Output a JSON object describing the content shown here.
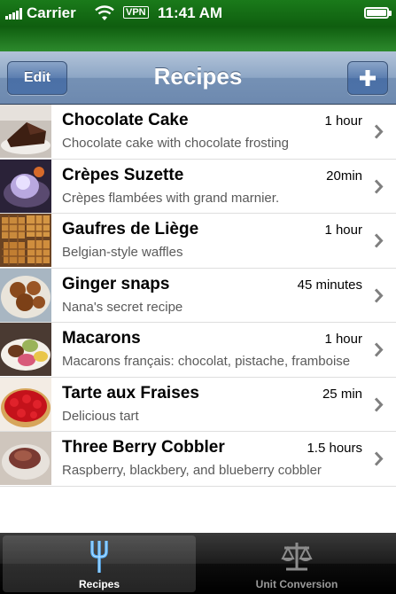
{
  "status_bar": {
    "carrier": "Carrier",
    "vpn": "VPN",
    "time": "11:41 AM"
  },
  "nav": {
    "title": "Recipes",
    "edit_label": "Edit",
    "add_icon": "plus-icon"
  },
  "recipes": [
    {
      "title": "Chocolate Cake",
      "time": "1 hour",
      "description": "Chocolate cake with chocolate frosting"
    },
    {
      "title": "Crèpes Suzette",
      "time": "20min",
      "description": "Crèpes flambées with grand marnier."
    },
    {
      "title": "Gaufres de Liège",
      "time": "1 hour",
      "description": "Belgian-style waffles"
    },
    {
      "title": "Ginger snaps",
      "time": "45 minutes",
      "description": "Nana's secret recipe"
    },
    {
      "title": "Macarons",
      "time": "1 hour",
      "description": "Macarons français: chocolat, pistache, framboise"
    },
    {
      "title": "Tarte aux Fraises",
      "time": "25 min",
      "description": "Delicious tart"
    },
    {
      "title": "Three Berry Cobbler",
      "time": "1.5 hours",
      "description": "Raspberry, blackbery, and blueberry cobbler"
    }
  ],
  "tabs": [
    {
      "label": "Recipes",
      "icon": "fork-icon",
      "selected": true
    },
    {
      "label": "Unit Conversion",
      "icon": "scale-icon",
      "selected": false
    }
  ],
  "colors": {
    "status_bar": "#0f5e0f",
    "nav_bar": "#7591b5",
    "tab_bar": "#1c1c1c"
  }
}
